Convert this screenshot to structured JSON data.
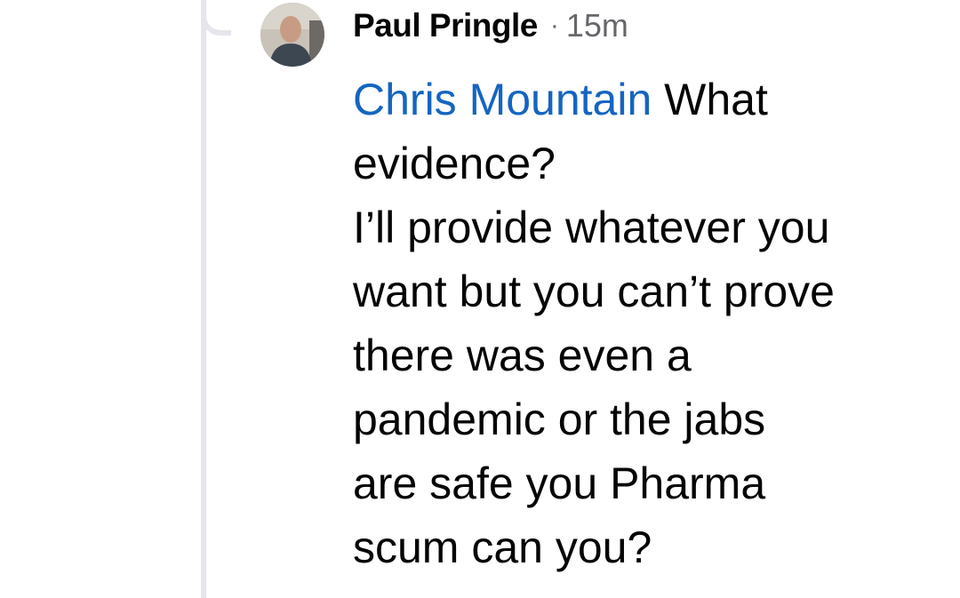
{
  "comment": {
    "author": "Paul Pringle",
    "separator": "·",
    "time": "15m",
    "mention": "Chris Mountain",
    "text": " What\nevidence?\nI’ll provide whatever you\nwant but you can’t prove\nthere was even a\npandemic or the jabs\nare safe you Pharma\nscum can you?"
  },
  "colors": {
    "mention": "#1565c0",
    "text": "#050505",
    "meta": "#65676b",
    "thread_line": "#e4e6eb"
  },
  "icons": {
    "avatar": "user-profile-photo"
  }
}
